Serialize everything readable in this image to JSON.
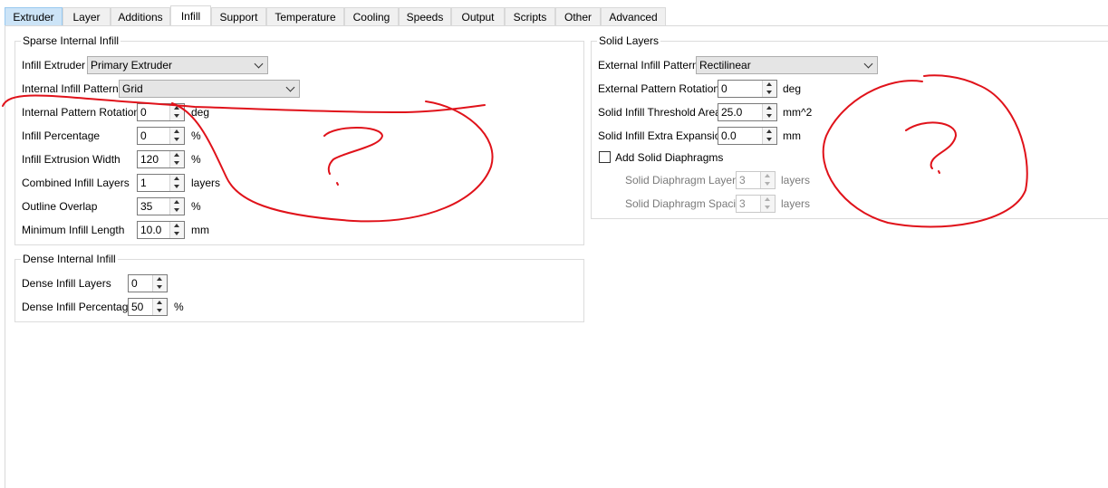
{
  "tabs": [
    {
      "label": "Extruder"
    },
    {
      "label": "Layer"
    },
    {
      "label": "Additions"
    },
    {
      "label": "Infill"
    },
    {
      "label": "Support"
    },
    {
      "label": "Temperature"
    },
    {
      "label": "Cooling"
    },
    {
      "label": "Speeds"
    },
    {
      "label": "Output"
    },
    {
      "label": "Scripts"
    },
    {
      "label": "Other"
    },
    {
      "label": "Advanced"
    }
  ],
  "active_tab": "Infill",
  "sparse": {
    "title": "Sparse Internal Infill",
    "infill_extruder": {
      "label": "Infill Extruder",
      "value": "Primary Extruder"
    },
    "internal_pattern": {
      "label": "Internal Infill Pattern",
      "value": "Grid"
    },
    "rotation": {
      "label": "Internal Pattern Rotation",
      "value": "0",
      "unit": "deg"
    },
    "percentage": {
      "label": "Infill Percentage",
      "value": "0",
      "unit": "%"
    },
    "extrusion_width": {
      "label": "Infill Extrusion Width",
      "value": "120",
      "unit": "%"
    },
    "combined_layers": {
      "label": "Combined Infill Layers",
      "value": "1",
      "unit": "layers"
    },
    "outline_overlap": {
      "label": "Outline Overlap",
      "value": "35",
      "unit": "%"
    },
    "min_length": {
      "label": "Minimum Infill Length",
      "value": "10.0",
      "unit": "mm"
    }
  },
  "dense": {
    "title": "Dense Internal Infill",
    "layers": {
      "label": "Dense Infill Layers",
      "value": "0"
    },
    "percentage": {
      "label": "Dense Infill Percentage",
      "value": "50",
      "unit": "%"
    }
  },
  "solid": {
    "title": "Solid Layers",
    "external_pattern": {
      "label": "External Infill Pattern",
      "value": "Rectilinear"
    },
    "external_rotation": {
      "label": "External Pattern Rotation",
      "value": "0",
      "unit": "deg"
    },
    "threshold_area": {
      "label": "Solid Infill Threshold Area",
      "value": "25.0",
      "unit": "mm^2"
    },
    "extra_expansion": {
      "label": "Solid Infill Extra Expansion",
      "value": "0.0",
      "unit": "mm"
    },
    "add_diaphragms": {
      "label": "Add Solid Diaphragms",
      "checked": false
    },
    "diaphragm_layers": {
      "label": "Solid Diaphragm Layers",
      "value": "3",
      "unit": "layers"
    },
    "diaphragm_spacing": {
      "label": "Solid Diaphragm Spacing",
      "value": "3",
      "unit": "layers"
    }
  },
  "annotation": {
    "color": "#e0121a"
  }
}
